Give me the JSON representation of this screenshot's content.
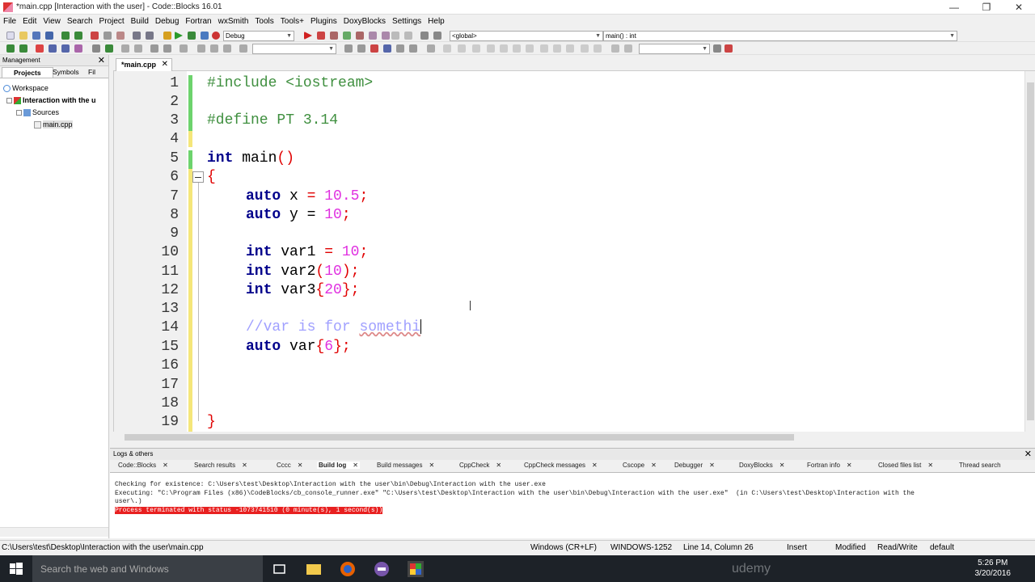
{
  "window": {
    "title": "*main.cpp [Interaction with the user] - Code::Blocks 16.01",
    "minimize": "—",
    "maximize": "❐",
    "close": "✕"
  },
  "menu": [
    "File",
    "Edit",
    "View",
    "Search",
    "Project",
    "Build",
    "Debug",
    "Fortran",
    "wxSmith",
    "Tools",
    "Tools+",
    "Plugins",
    "DoxyBlocks",
    "Settings",
    "Help"
  ],
  "toolbar": {
    "build_target": "Debug",
    "scope": "<global>",
    "function": "main() : int"
  },
  "management": {
    "title": "Management",
    "close": "✕",
    "tabs": [
      "Projects",
      "Symbols",
      "Fil"
    ],
    "tree": {
      "workspace": "Workspace",
      "project": "Interaction with the u",
      "folder": "Sources",
      "file": "main.cpp"
    }
  },
  "editor": {
    "tab_label": "*main.cpp",
    "tab_close": "✕",
    "line_numbers": [
      "1",
      "2",
      "3",
      "4",
      "5",
      "6",
      "7",
      "8",
      "9",
      "10",
      "11",
      "12",
      "13",
      "14",
      "15",
      "16",
      "17",
      "18",
      "19"
    ]
  },
  "code": {
    "l1": "#include <iostream>",
    "l3": "#define PT 3.14",
    "l5_kw": "int",
    "l5_name": " main",
    "l5_paren": "()",
    "l6": "{",
    "l7_kw": "auto",
    "l7_var": " x ",
    "l7_eq": "=",
    "l7_num": " 10.5",
    "l7_semi": ";",
    "l8_kw": "auto",
    "l8_var": " y = ",
    "l8_num": "10",
    "l8_semi": ";",
    "l10_kw": "int",
    "l10_var": " var1 ",
    "l10_eq": "=",
    "l10_num": " 10",
    "l10_semi": ";",
    "l11_kw": "int",
    "l11_var": " var2",
    "l11_lp": "(",
    "l11_num": "10",
    "l11_rp": ")",
    "l11_semi": ";",
    "l12_kw": "int",
    "l12_var": " var3",
    "l12_lb": "{",
    "l12_num": "20",
    "l12_rb": "}",
    "l12_semi": ";",
    "l14_comment": "//var is for ",
    "l14_squiggle": "somethi",
    "l15_kw": "auto",
    "l15_var": " var",
    "l15_lb": "{",
    "l15_num": "6",
    "l15_rb": "}",
    "l15_semi": ";",
    "l19": "}"
  },
  "logs": {
    "title": "Logs & others",
    "close": "✕",
    "tabs": [
      "Code::Blocks",
      "Search results",
      "Cccc",
      "Build log",
      "Build messages",
      "CppCheck",
      "CppCheck messages",
      "Cscope",
      "Debugger",
      "DoxyBlocks",
      "Fortran info",
      "Closed files list",
      "Thread search"
    ],
    "active_tab": "Build log",
    "lines": [
      "Checking for existence: C:\\Users\\test\\Desktop\\Interaction with the user\\bin\\Debug\\Interaction with the user.exe",
      "Executing: \"C:\\Program Files (x86)\\CodeBlocks/cb_console_runner.exe\" \"C:\\Users\\test\\Desktop\\Interaction with the user\\bin\\Debug\\Interaction with the user.exe\"  (in C:\\Users\\test\\Desktop\\Interaction with the",
      "user\\.)"
    ],
    "error_line": "Process terminated with status -1073741510 (0 minute(s), 1 second(s))"
  },
  "status": {
    "path": "C:\\Users\\test\\Desktop\\Interaction with the user\\main.cpp",
    "eol": "Windows (CR+LF)",
    "encoding": "WINDOWS-1252",
    "position": "Line 14, Column 26",
    "mode": "Insert",
    "modified": "Modified",
    "access": "Read/Write",
    "lang": "default"
  },
  "taskbar": {
    "search_placeholder": "Search the web and Windows",
    "watermark": "udemy",
    "time": "5:26 PM",
    "date": "3/20/2016"
  }
}
